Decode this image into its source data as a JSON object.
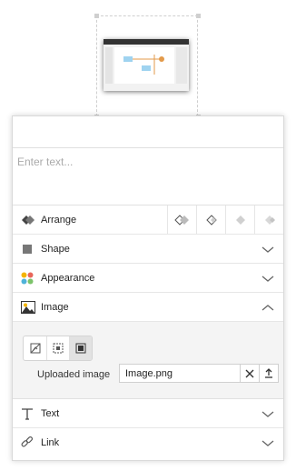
{
  "text_editor": {
    "placeholder": "Enter text..."
  },
  "sections": {
    "arrange": {
      "label": "Arrange"
    },
    "shape": {
      "label": "Shape"
    },
    "appearance": {
      "label": "Appearance"
    },
    "image": {
      "label": "Image"
    },
    "text": {
      "label": "Text"
    },
    "link": {
      "label": "Link"
    }
  },
  "image_panel": {
    "uploaded_label": "Uploaded image",
    "filename": "Image.png"
  },
  "colors": {
    "accent": "#333333",
    "muted": "#aaaaaa",
    "panel_bg": "#f4f4f4"
  }
}
